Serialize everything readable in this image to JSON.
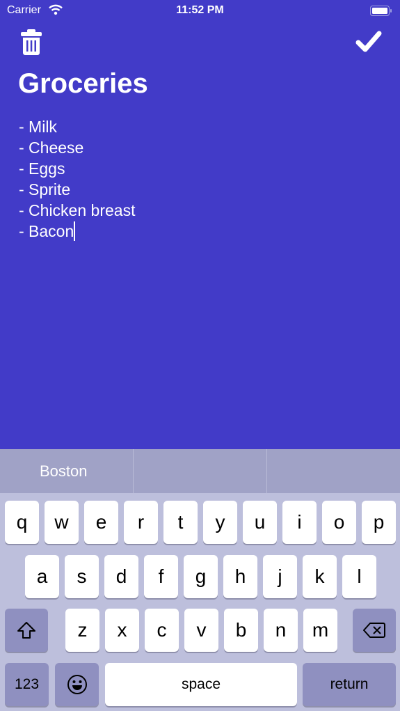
{
  "status": {
    "carrier": "Carrier",
    "time": "11:52 PM"
  },
  "note": {
    "title": "Groceries",
    "lines": [
      "- Milk",
      "- Cheese",
      "- Eggs",
      "- Sprite",
      "- Chicken breast",
      "- Bacon"
    ]
  },
  "keyboard": {
    "suggestions": [
      "Boston",
      "",
      ""
    ],
    "row1": [
      "q",
      "w",
      "e",
      "r",
      "t",
      "y",
      "u",
      "i",
      "o",
      "p"
    ],
    "row2": [
      "a",
      "s",
      "d",
      "f",
      "g",
      "h",
      "j",
      "k",
      "l"
    ],
    "row3": [
      "z",
      "x",
      "c",
      "v",
      "b",
      "n",
      "m"
    ],
    "numbers_label": "123",
    "space_label": "space",
    "return_label": "return"
  },
  "colors": {
    "background": "#423bc8",
    "keyboard": "#bdbfdc"
  }
}
